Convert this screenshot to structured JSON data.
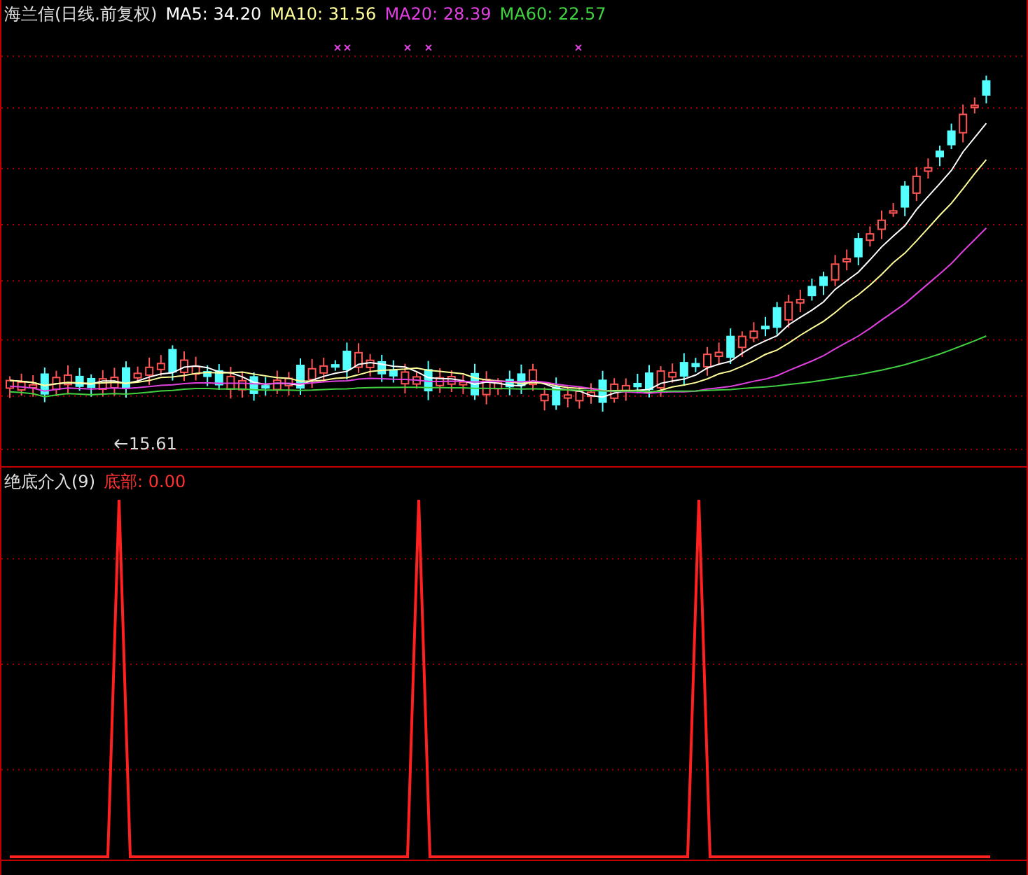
{
  "main_pane": {
    "title": "海兰信(日线.前复权)",
    "moving_averages": [
      {
        "label": "MA5:",
        "value": "34.20",
        "color": "#ffffff"
      },
      {
        "label": "MA10:",
        "value": "31.56",
        "color": "#ffff99"
      },
      {
        "label": "MA20:",
        "value": "28.39",
        "color": "#e040e0"
      },
      {
        "label": "MA60:",
        "value": "22.57",
        "color": "#40d040"
      }
    ],
    "low_marker": "15.61"
  },
  "indicator_pane": {
    "title": "绝底介入(9)",
    "label": "底部:",
    "value": "0.00"
  }
}
